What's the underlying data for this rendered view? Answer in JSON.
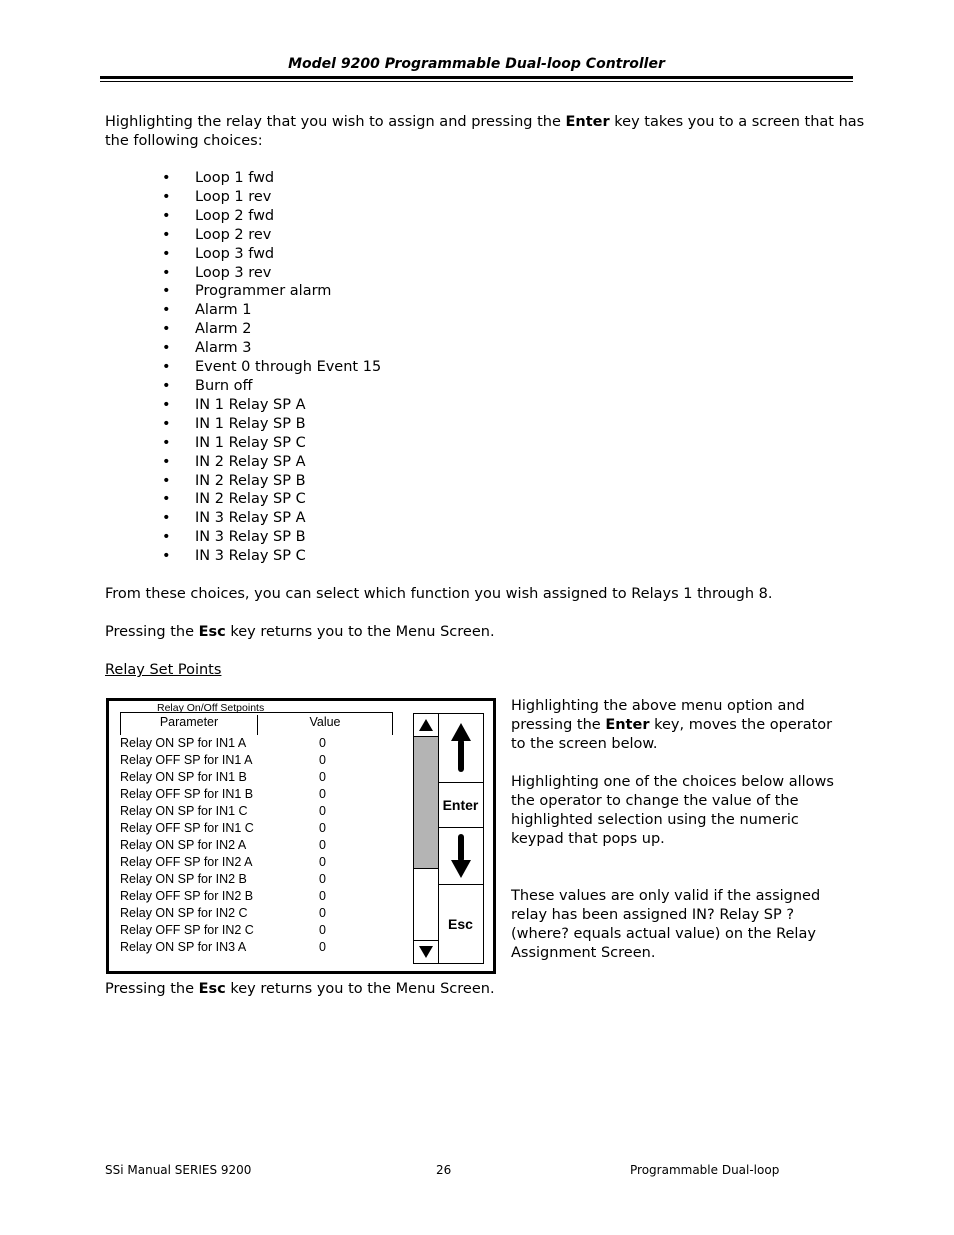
{
  "header": {
    "title": "Model 9200 Programmable Dual-loop Controller"
  },
  "intro": {
    "before_bold": "Highlighting the relay that you wish to assign and pressing the ",
    "bold": "Enter",
    "after_bold_line1": " key takes you to a screen that has",
    "line2": "the following choices:"
  },
  "choices": [
    "Loop 1 fwd",
    "Loop 1 rev",
    "Loop 2 fwd",
    "Loop 2 rev",
    "Loop 3 fwd",
    "Loop 3 rev",
    "Programmer alarm",
    "Alarm 1",
    "Alarm 2",
    "Alarm 3",
    "Event 0 through Event 15",
    "Burn off",
    "IN 1 Relay SP A",
    "IN 1 Relay SP B",
    "IN 1 Relay SP C",
    "IN 2 Relay SP A",
    "IN 2 Relay SP B",
    "IN 2 Relay SP C",
    "IN 3 Relay SP A",
    "IN 3 Relay SP B",
    "IN 3 Relay SP C"
  ],
  "bullet_glyph": "•",
  "after_choices": "From these choices, you can select which function you wish assigned to Relays 1 through 8.",
  "esc_note_1": {
    "before": "Pressing the ",
    "bold": "Esc",
    "after": " key returns you to the Menu Screen."
  },
  "section_heading": "Relay Set Points",
  "screen": {
    "title": "Relay On/Off Setpoints",
    "columns": [
      "Parameter",
      "Value"
    ],
    "rows": [
      {
        "param": "Relay ON SP for IN1 A",
        "value": "0"
      },
      {
        "param": "Relay OFF SP for IN1 A",
        "value": "0"
      },
      {
        "param": "Relay ON SP for IN1 B",
        "value": "0"
      },
      {
        "param": "Relay OFF SP for IN1 B",
        "value": "0"
      },
      {
        "param": "Relay ON SP for IN1 C",
        "value": "0"
      },
      {
        "param": "Relay OFF SP for IN1 C",
        "value": "0"
      },
      {
        "param": "Relay ON SP for IN2 A",
        "value": "0"
      },
      {
        "param": "Relay OFF SP for IN2 A",
        "value": "0"
      },
      {
        "param": "Relay ON SP for IN2 B",
        "value": "0"
      },
      {
        "param": "Relay OFF SP for IN2 B",
        "value": "0"
      },
      {
        "param": "Relay ON SP for IN2 C",
        "value": "0"
      },
      {
        "param": "Relay OFF SP for IN2 C",
        "value": "0"
      },
      {
        "param": "Relay ON SP for IN3 A",
        "value": "0"
      }
    ],
    "keys": {
      "up": "up-arrow",
      "enter": "Enter",
      "down": "down-arrow",
      "esc": "Esc"
    },
    "scrollbar_thumb_color": "#b4b4b4"
  },
  "side_text": {
    "p1_before": "Highlighting the above menu option and pressing the ",
    "p1_bold": "Enter",
    "p1_after": " key, moves the operator to the screen below.",
    "p2": "Highlighting one of the choices below allows the operator to change the value of the highlighted selection using the numeric keypad that pops up.",
    "p3": "These values are only valid if the assigned relay has been assigned IN? Relay SP ? (where? equals actual value) on the Relay Assignment Screen."
  },
  "esc_note_2": {
    "before": "Pressing the ",
    "bold": "Esc",
    "after": " key returns you to the Menu Screen."
  },
  "footer": {
    "left": "SSi Manual SERIES 9200",
    "center": "26",
    "right": "Programmable Dual-loop"
  }
}
